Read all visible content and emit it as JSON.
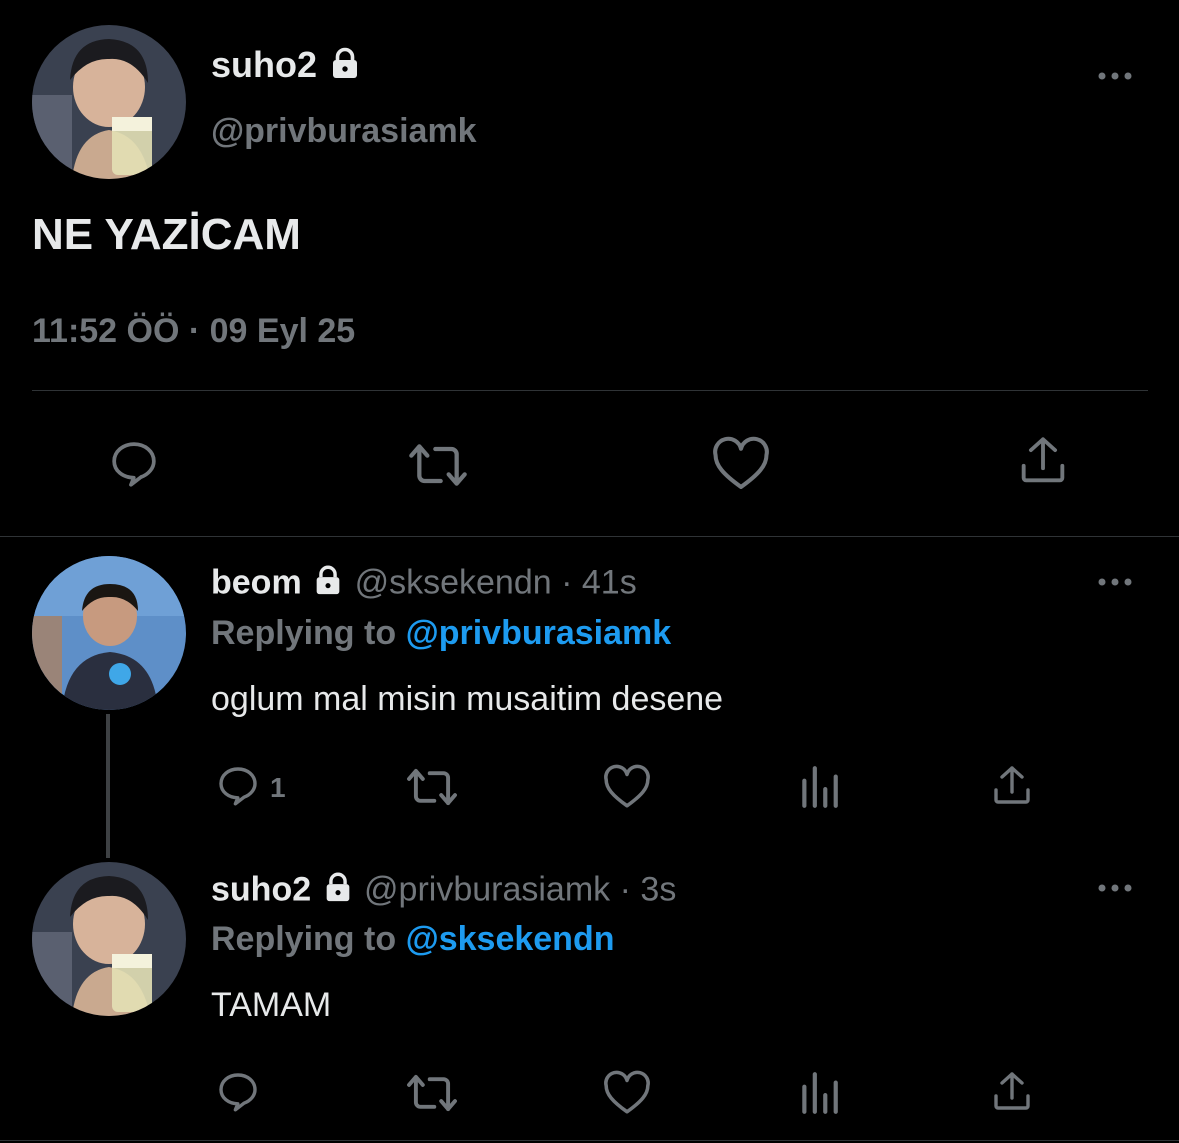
{
  "main_tweet": {
    "display_name": "suho2",
    "handle": "@privburasiamk",
    "text": "NE YAZİCAM",
    "timestamp": "11:52 ÖÖ · 09 Eyl 25"
  },
  "replies": [
    {
      "display_name": "beom",
      "handle": "@sksekendn",
      "separator": "·",
      "time": "41s",
      "replying_prefix": "Replying to",
      "replying_to": "@privburasiamk",
      "text": "oglum mal misin musaitim desene",
      "reply_count": "1"
    },
    {
      "display_name": "suho2",
      "handle": "@privburasiamk",
      "separator": "·",
      "time": "3s",
      "replying_prefix": "Replying to",
      "replying_to": "@sksekendn",
      "text": "TAMAM",
      "reply_count": ""
    }
  ],
  "colors": {
    "background": "#000000",
    "text": "#e7e9ea",
    "secondary": "#71767b",
    "link": "#1d9bf0",
    "divider": "#2f3336"
  },
  "icons": [
    "lock-icon",
    "more-icon",
    "reply-icon",
    "retweet-icon",
    "like-icon",
    "analytics-icon",
    "share-icon"
  ]
}
